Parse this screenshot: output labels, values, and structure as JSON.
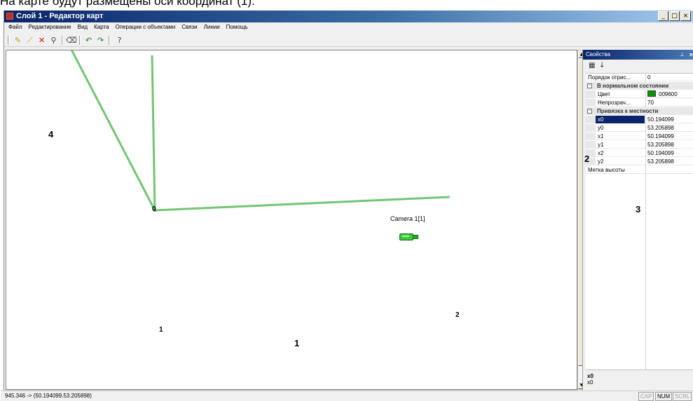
{
  "caption": "На карте будут размещены оси координат (1).",
  "window": {
    "title": "Слой 1 - Редактор карт",
    "buttons": [
      "_",
      "□",
      "×"
    ]
  },
  "menu": [
    "Файл",
    "Редактирование",
    "Вид",
    "Карта",
    "Операции с объектами",
    "Связи",
    "Линии",
    "Помощь"
  ],
  "toolbar": {
    "icons": [
      "add-point-icon",
      "draw-line-icon",
      "delete-icon",
      "node-icon",
      "erase-icon",
      "undo-icon",
      "redo-icon",
      "help-icon"
    ],
    "labels": [
      "✎",
      "⟋",
      "✕",
      "⚲",
      "⌫",
      "↶",
      "↷",
      "?"
    ],
    "colors": {
      "add": "#c8a000",
      "line": "#c8a000",
      "delete": "#d01010",
      "node": "#404040",
      "undo": "#2a7a2a"
    }
  },
  "map": {
    "axis_color": "#009600",
    "axis_opacity_percent": 70,
    "axis_labels": [
      "0",
      "1",
      "2"
    ],
    "camera_label": "Camera 1[1]",
    "camera_color": "#33cc33"
  },
  "annotations": [
    "1",
    "2",
    "3",
    "4"
  ],
  "properties": {
    "title": "Свойства",
    "pin": "⊥",
    "close": "×",
    "rows": [
      {
        "type": "prop",
        "name": "Порядок отрис...",
        "value": "0"
      },
      {
        "type": "cat",
        "name": "В нормальном состоянии",
        "toggle": "−"
      },
      {
        "type": "sub",
        "name": "Цвет",
        "value": "009600",
        "swatch": "#009600"
      },
      {
        "type": "sub",
        "name": "Непрозрач...",
        "value": "70"
      },
      {
        "type": "cat",
        "name": "Привязка к местности",
        "toggle": "−"
      },
      {
        "type": "sub",
        "name": "x0",
        "value": "50.194099",
        "selected": true
      },
      {
        "type": "sub",
        "name": "y0",
        "value": "53.205898"
      },
      {
        "type": "sub",
        "name": "x1",
        "value": "50.194099"
      },
      {
        "type": "sub",
        "name": "y1",
        "value": "53.205898"
      },
      {
        "type": "sub",
        "name": "x2",
        "value": "50.194099"
      },
      {
        "type": "sub",
        "name": "y2",
        "value": "53.205898"
      },
      {
        "type": "prop",
        "name": "Метка высоты",
        "value": ""
      }
    ],
    "desc_title": "x0",
    "desc_text": "x0"
  },
  "status": {
    "text": "945.346 -> (50.194099.53.205898)",
    "indicators": [
      {
        "label": "CAP",
        "on": false
      },
      {
        "label": "NUM",
        "on": true
      },
      {
        "label": "SCRL",
        "on": false
      }
    ]
  }
}
